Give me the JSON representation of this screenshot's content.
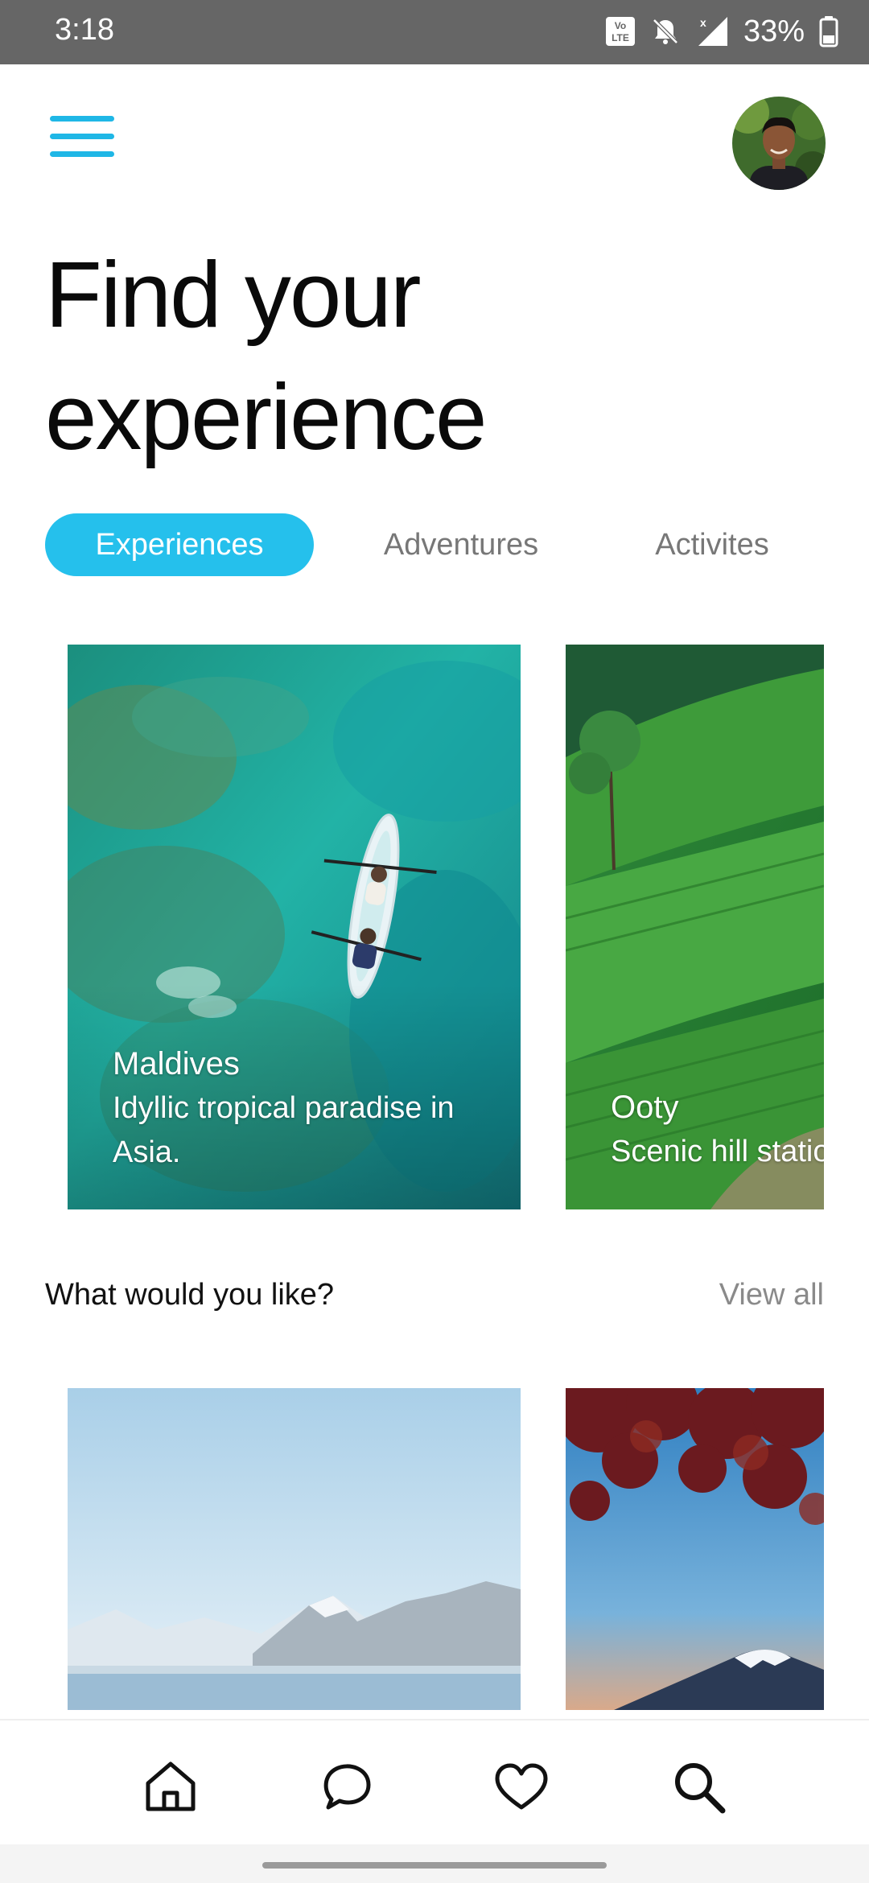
{
  "status_bar": {
    "time": "3:18",
    "battery": "33%",
    "icons": [
      "volte-icon",
      "bell-muted-icon",
      "signal-icon",
      "battery-icon"
    ]
  },
  "header": {
    "title_line1": "Find your",
    "title_line2": "experience",
    "menu_icon": "hamburger-icon",
    "avatar": "profile-avatar"
  },
  "tabs": [
    {
      "label": "Experiences",
      "active": true
    },
    {
      "label": "Adventures",
      "active": false
    },
    {
      "label": "Activites",
      "active": false
    }
  ],
  "featured": [
    {
      "title": "Maldives",
      "subtitle_line1": "Idyllic tropical paradise in",
      "subtitle_line2": "Asia."
    },
    {
      "title": "Ooty",
      "subtitle_line1": "Scenic hill station"
    }
  ],
  "section": {
    "title": "What would you like?",
    "view_all": "View all"
  },
  "bottom_nav": [
    "home-icon",
    "chat-icon",
    "heart-icon",
    "search-icon"
  ],
  "colors": {
    "accent": "#25c0ec",
    "menu": "#1fb7e6",
    "status_bar": "#666666"
  }
}
